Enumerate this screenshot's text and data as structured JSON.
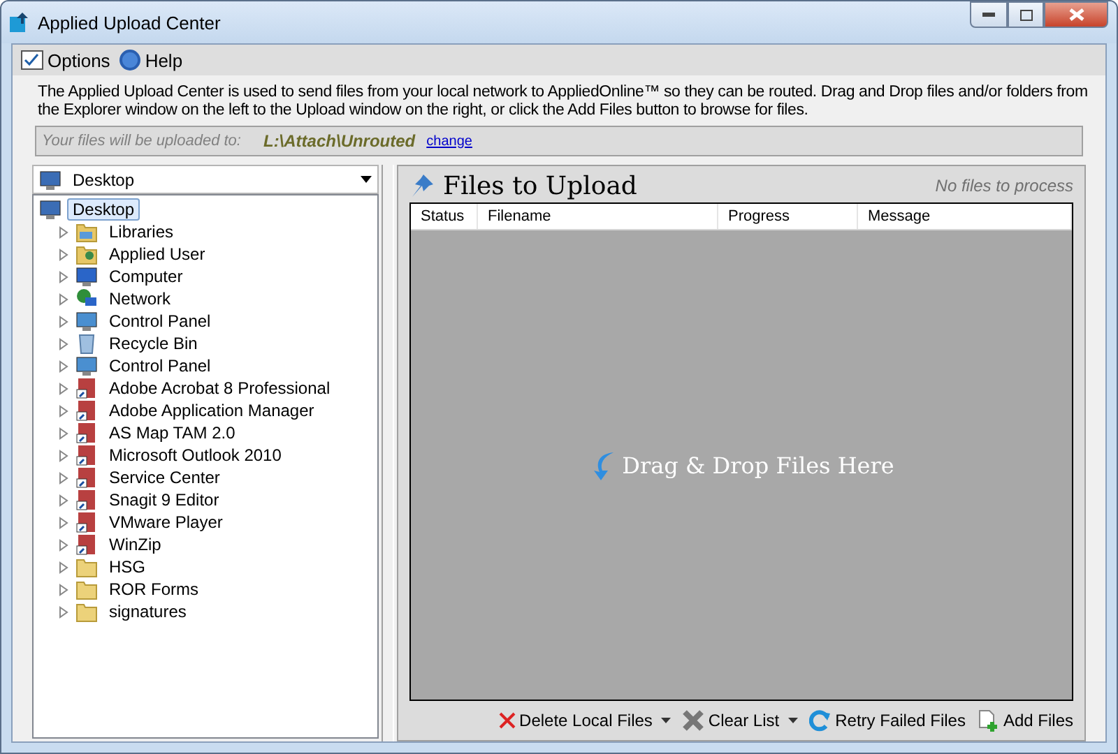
{
  "window": {
    "title": "Applied Upload Center"
  },
  "toolbar": [
    {
      "label": "Options",
      "kind": "options"
    },
    {
      "label": "Help",
      "kind": "help"
    }
  ],
  "description": "The Applied Upload Center is used to send files from your local network to AppliedOnline™ so they can be routed.  Drag and Drop files and/or folders from the Explorer window on the left to the Upload window on the right,  or click the Add Files button to browse for files.",
  "destination": {
    "label": "Your files will be uploaded to:",
    "path": "L:\\Attach\\Unrouted",
    "link": "change"
  },
  "explorer": {
    "location": "Desktop",
    "tree": [
      {
        "label": "Desktop",
        "kind": "desktop",
        "selected": true,
        "children": [
          {
            "label": "Libraries",
            "kind": "library",
            "selected": false
          },
          {
            "label": "Applied User",
            "kind": "user",
            "selected": false
          },
          {
            "label": "Computer",
            "kind": "computer",
            "selected": false
          },
          {
            "label": "Network",
            "kind": "network",
            "selected": false
          },
          {
            "label": "Control Panel",
            "kind": "control",
            "selected": false
          },
          {
            "label": "Recycle Bin",
            "kind": "recycle",
            "selected": false
          },
          {
            "label": "Control Panel",
            "kind": "control",
            "selected": false
          },
          {
            "label": "Adobe Acrobat 8 Professional",
            "kind": "shortcut",
            "selected": false
          },
          {
            "label": "Adobe Application Manager",
            "kind": "shortcut",
            "selected": false
          },
          {
            "label": "AS Map TAM 2.0",
            "kind": "shortcut",
            "selected": false
          },
          {
            "label": "Microsoft Outlook 2010",
            "kind": "shortcut",
            "selected": false
          },
          {
            "label": "Service Center",
            "kind": "shortcut",
            "selected": false
          },
          {
            "label": "Snagit 9 Editor",
            "kind": "shortcut",
            "selected": false
          },
          {
            "label": "VMware Player",
            "kind": "shortcut",
            "selected": false
          },
          {
            "label": "WinZip",
            "kind": "shortcut",
            "selected": false
          },
          {
            "label": "HSG",
            "kind": "folder",
            "selected": false
          },
          {
            "label": "ROR Forms",
            "kind": "folder",
            "selected": false
          },
          {
            "label": "signatures",
            "kind": "folder",
            "selected": false
          }
        ]
      }
    ]
  },
  "upload": {
    "title": "Files to Upload",
    "status": "No files to process",
    "columns": [
      "Status",
      "Filename",
      "Progress",
      "Message"
    ],
    "drop_hint": "Drag & Drop Files Here",
    "actions": [
      {
        "label": "Delete Local Files",
        "kind": "delete",
        "dropdown": true
      },
      {
        "label": "Clear List",
        "kind": "clear",
        "dropdown": true
      },
      {
        "label": "Retry Failed Files",
        "kind": "retry",
        "dropdown": false
      },
      {
        "label": "Add Files",
        "kind": "add",
        "dropdown": false
      }
    ]
  }
}
